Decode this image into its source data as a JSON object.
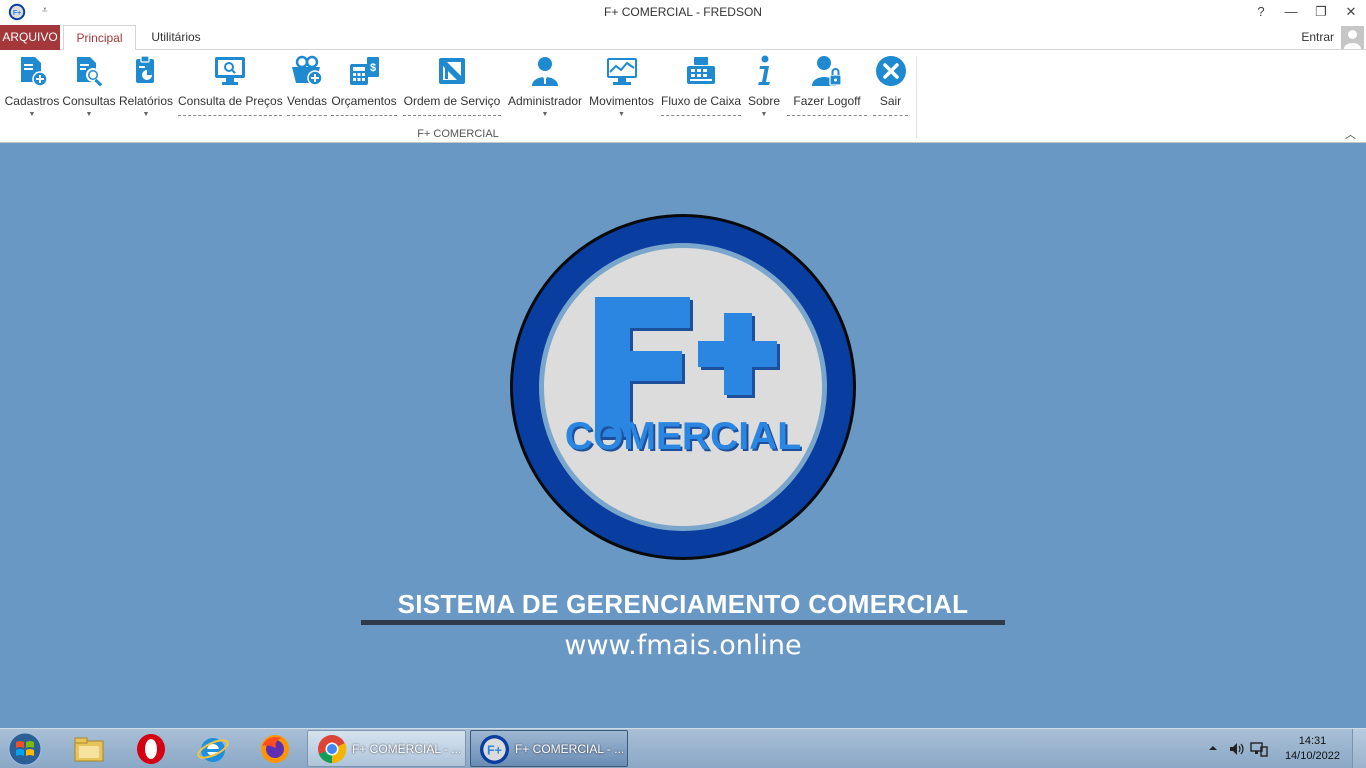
{
  "window": {
    "title": "F+ COMERCIAL - FREDSON",
    "qat_symbol": "⩡",
    "help": "?",
    "minimize": "—",
    "restore": "❐",
    "close": "✕"
  },
  "tabs": {
    "file": "ARQUIVO",
    "items": [
      "Principal",
      "Utilitários"
    ],
    "active": "Principal",
    "login": "Entrar"
  },
  "ribbon": {
    "group_label": "F+ COMERCIAL",
    "buttons": [
      {
        "label": "Cadastros",
        "icon": "document-add-icon",
        "dropdown": true
      },
      {
        "label": "Consultas",
        "icon": "document-search-icon",
        "dropdown": true
      },
      {
        "label": "Relatórios",
        "icon": "clipboard-chart-icon",
        "dropdown": true
      },
      {
        "label": "Consulta de Preços",
        "icon": "monitor-search-icon",
        "dropdown": false
      },
      {
        "label": "Vendas",
        "icon": "basket-add-icon",
        "dropdown": false
      },
      {
        "label": "Orçamentos",
        "icon": "calculator-money-icon",
        "dropdown": false
      },
      {
        "label": "Ordem de Serviço",
        "icon": "work-order-icon",
        "dropdown": false
      },
      {
        "label": "Administrador",
        "icon": "admin-user-icon",
        "dropdown": true
      },
      {
        "label": "Movimentos",
        "icon": "monitor-chart-icon",
        "dropdown": true
      },
      {
        "label": "Fluxo de Caixa",
        "icon": "cash-register-icon",
        "dropdown": false
      },
      {
        "label": "Sobre",
        "icon": "info-icon",
        "dropdown": true
      },
      {
        "label": "Fazer Logoff",
        "icon": "user-lock-icon",
        "dropdown": false
      },
      {
        "label": "Sair",
        "icon": "close-circle-icon",
        "dropdown": false
      }
    ],
    "collapse_symbol": "︿"
  },
  "main": {
    "logo_text_big": "F+",
    "logo_text_small": "COMERCIAL",
    "slogan": "SISTEMA DE GERENCIAMENTO COMERCIAL",
    "website": "www.fmais.online"
  },
  "taskbar": {
    "pinned": [
      "start-orb-icon",
      "file-explorer-icon",
      "opera-icon",
      "internet-explorer-icon",
      "firefox-icon"
    ],
    "windows": [
      {
        "label": "F+ COMERCIAL - ...",
        "icon": "chrome-icon",
        "active": false
      },
      {
        "label": "F+ COMERCIAL - ...",
        "icon": "fplus-app-icon",
        "active": true
      }
    ],
    "time": "14:31",
    "date": "14/10/2022"
  },
  "colors": {
    "accent_red": "#a4373a",
    "icon_blue": "#1f8ad0",
    "background": "#6a98c4",
    "logo_dark_blue": "#0a3da0",
    "logo_letter_blue": "#2a86e0"
  }
}
